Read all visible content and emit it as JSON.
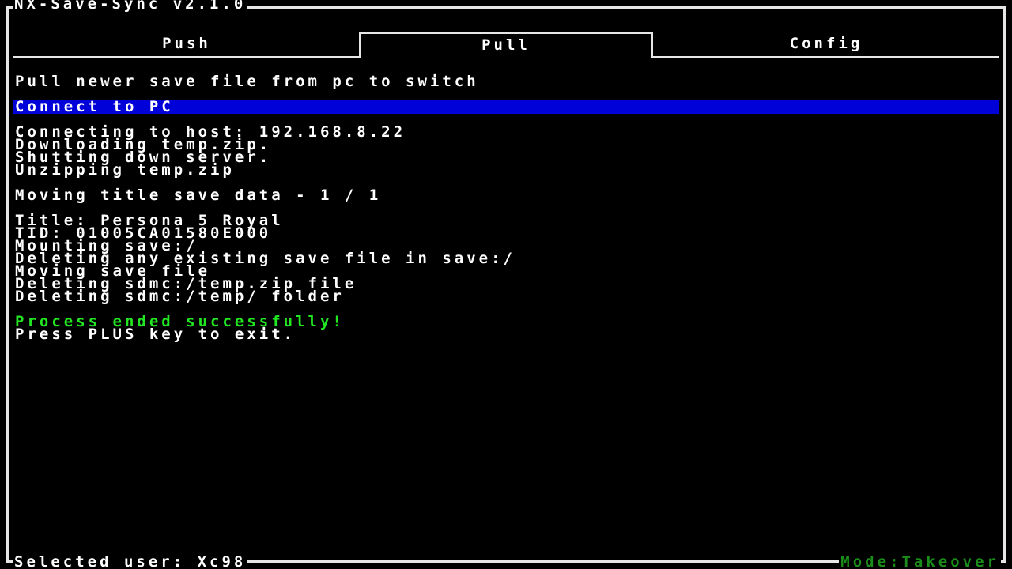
{
  "app": {
    "title": "NX-Save-Sync v2.1.0"
  },
  "tabs": [
    {
      "label": "Push",
      "selected": false
    },
    {
      "label": "Pull",
      "selected": true
    },
    {
      "label": "Config",
      "selected": false
    }
  ],
  "pull": {
    "description": "Pull newer save file from pc to switch",
    "menu_item": "Connect to PC",
    "log_block1": [
      "Connecting to host: 192.168.8.22",
      "Downloading temp.zip.",
      "Shutting down server.",
      "Unzipping temp.zip"
    ],
    "progress_line": "Moving title save data - 1 / 1",
    "log_block2": [
      "Title: Persona 5 Royal",
      "TID: 01005CA01580E000",
      "Mounting save:/",
      "Deleting any existing save file in save:/",
      "Moving save file",
      "Deleting sdmc:/temp.zip file",
      "Deleting sdmc:/temp/ folder"
    ],
    "success_message": "Process ended successfully!",
    "exit_hint": "Press PLUS key to exit."
  },
  "footer": {
    "selected_user": "Selected user: Xc98",
    "mode": "Mode:Takeover"
  },
  "colors": {
    "background": "#000000",
    "text": "#ffffff",
    "highlight": "#0000d8",
    "success": "#22e622",
    "mode": "#1a8c1a"
  }
}
